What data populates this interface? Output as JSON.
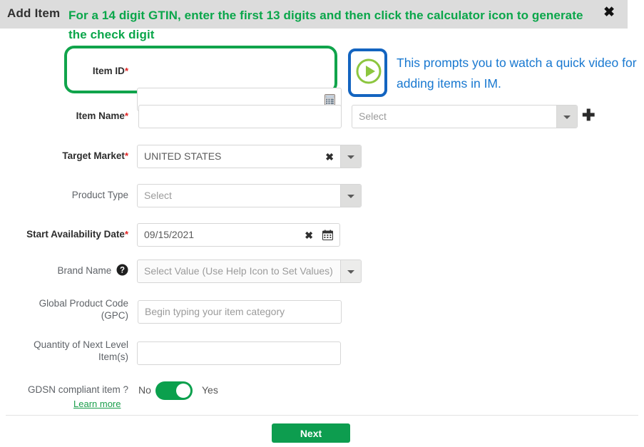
{
  "window": {
    "title": "Add Item",
    "close_icon": "close-icon"
  },
  "annotations": {
    "green_note": "For a 14 digit GTIN, enter the first 13 digits and then click the calculator icon to generate the check digit",
    "blue_note": "This prompts you to watch a quick video for adding items in IM.",
    "green_color": "#0aa64a",
    "blue_color": "#1878d0",
    "green_box_color": "#10a44b",
    "blue_box_color": "#1364c0"
  },
  "form": {
    "item_id": {
      "label": "Item ID",
      "required": "*",
      "value": "",
      "placeholder": "",
      "icon": "calculator-icon"
    },
    "item_name": {
      "label": "Item Name",
      "required": "*",
      "value": "",
      "placeholder": ""
    },
    "item_name_select": {
      "placeholder": "Select",
      "add_icon": "plus-icon"
    },
    "target_market": {
      "label": "Target Market",
      "required": "*",
      "value": "UNITED STATES",
      "clear_icon": "clear-icon"
    },
    "product_type": {
      "label": "Product Type",
      "placeholder": "Select"
    },
    "start_availability_date": {
      "label": "Start Availability Date",
      "required": "*",
      "value": "09/15/2021",
      "clear_icon": "clear-icon",
      "calendar_icon": "calendar-icon"
    },
    "brand_name": {
      "label": "Brand Name",
      "help_icon": "help-icon",
      "placeholder": "Select Value (Use Help Icon to Set Values)"
    },
    "gpc": {
      "label_line1": "Global Product Code",
      "label_line2": "(GPC)",
      "placeholder": "Begin typing your item category"
    },
    "quantity_next_level": {
      "label_line1": "Quantity of Next Level",
      "label_line2": "Item(s)",
      "value": "",
      "placeholder": ""
    },
    "gdsn": {
      "label": "GDSN compliant item ?",
      "off_label": "No",
      "on_label": "Yes",
      "state": "Yes",
      "toggle_color": "#0ba04d",
      "learn_more": "Learn more"
    }
  },
  "footer": {
    "next_label": "Next",
    "next_color": "#0d9d4f"
  }
}
